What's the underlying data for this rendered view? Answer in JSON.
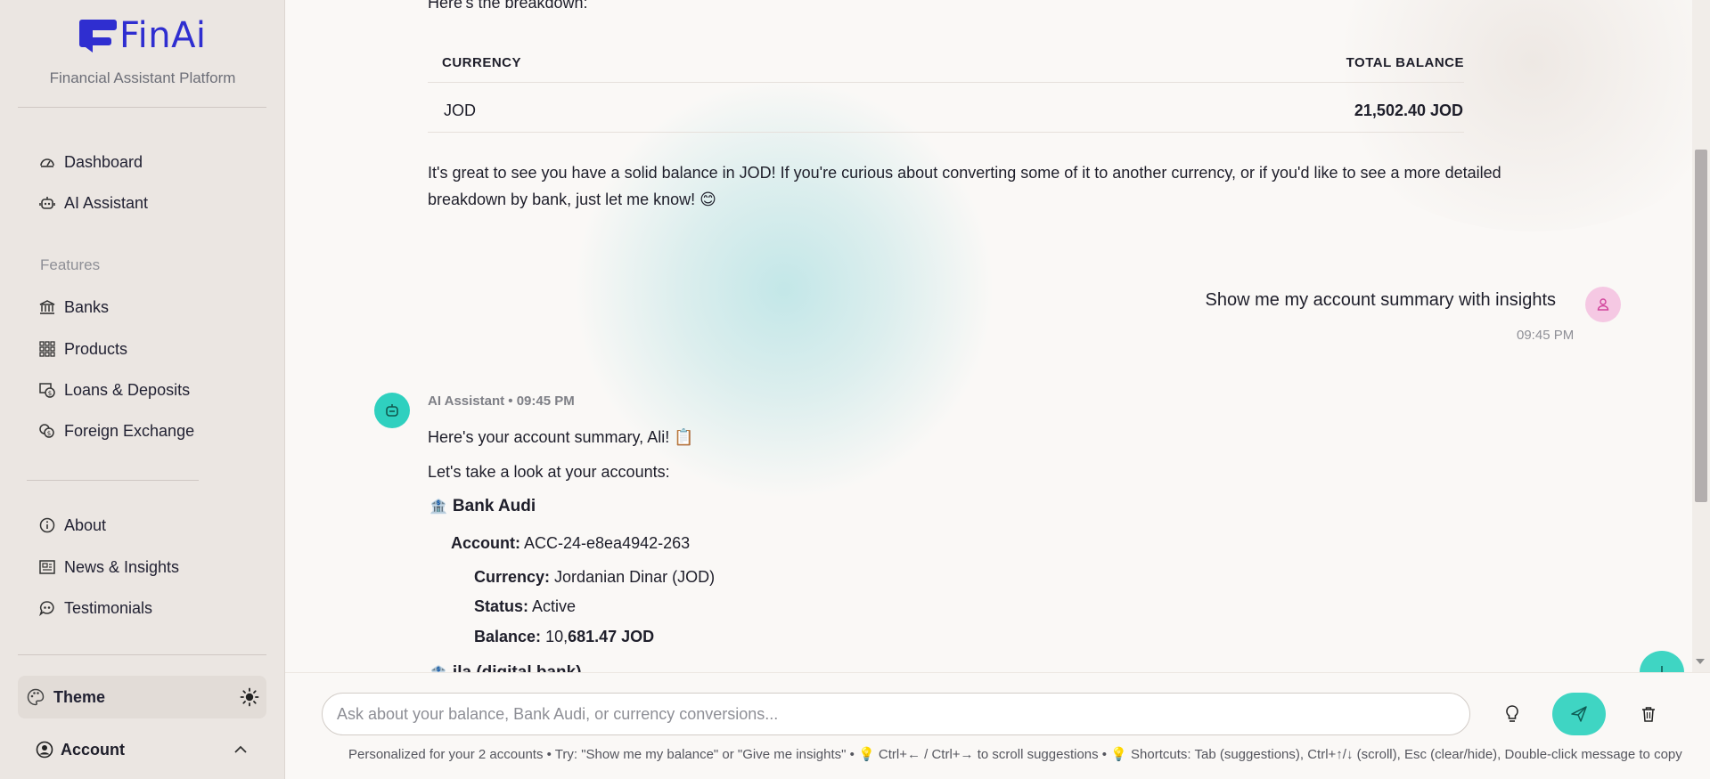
{
  "app": {
    "name": "FinAi",
    "tagline": "Financial Assistant Platform"
  },
  "sidebar": {
    "primary": [
      {
        "label": "Dashboard",
        "icon": "dashboard-icon"
      },
      {
        "label": "AI Assistant",
        "icon": "robot-icon"
      }
    ],
    "section_label": "Features",
    "features": [
      {
        "label": "Banks",
        "icon": "bank-icon"
      },
      {
        "label": "Products",
        "icon": "grid-icon"
      },
      {
        "label": "Loans & Deposits",
        "icon": "loan-icon"
      },
      {
        "label": "Foreign Exchange",
        "icon": "exchange-icon"
      }
    ],
    "secondary": [
      {
        "label": "About",
        "icon": "info-icon"
      },
      {
        "label": "News & Insights",
        "icon": "newspaper-icon"
      },
      {
        "label": "Testimonials",
        "icon": "quote-icon"
      }
    ],
    "theme_label": "Theme",
    "account_label": "Account"
  },
  "chat": {
    "intro_text": "Here's the breakdown:",
    "table": {
      "headers": [
        "CURRENCY",
        "TOTAL BALANCE"
      ],
      "rows": [
        [
          "JOD",
          "21,502.40 JOD"
        ]
      ]
    },
    "followup_line1": "It's great to see you have a solid balance in JOD! If you're curious about converting some of it to another currency, or if you'd like to see a more detailed",
    "followup_line2": "breakdown by bank, just let me know! 😊",
    "user_message": "Show me my account summary with insights",
    "user_time": "09:45 PM",
    "assistant_meta": "AI Assistant • 09:45 PM",
    "summary_greeting": "Here's your account summary, Ali! 📋",
    "summary_intro": "Let's take a look at your accounts:",
    "banks": [
      {
        "name": "Bank Audi",
        "account_label": "Account:",
        "account_value": "ACC-24-e8ea4942-263",
        "currency_label": "Currency:",
        "currency_value": "Jordanian Dinar (JOD)",
        "status_label": "Status:",
        "status_value": "Active",
        "balance_label": "Balance:",
        "balance_prefix": "10,",
        "balance_rest": "681.47 JOD"
      },
      {
        "name": "ila (digital bank)"
      }
    ]
  },
  "composer": {
    "placeholder": "Ask about your balance, Bank Audi, or currency conversions...",
    "hint": "Personalized for your 2 accounts • Try: \"Show me my balance\" or \"Give me insights\" • 💡 Ctrl+← / Ctrl+→ to scroll suggestions • 💡 Shortcuts: Tab (suggestions), Ctrl+↑/↓ (scroll), Esc (clear/hide), Double-click message to copy"
  },
  "colors": {
    "brand": "#2f2ed0",
    "accent": "#3fd5c3",
    "user_avatar": "#f5c8e3"
  }
}
